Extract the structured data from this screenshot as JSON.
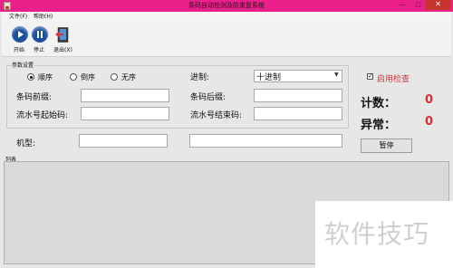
{
  "window": {
    "title": "条码自动检测及防重复系统",
    "controls": {
      "minimize": "—",
      "maximize": "□",
      "close": "✕"
    }
  },
  "menu": {
    "file": "文件(F)",
    "help": "帮助(H)"
  },
  "toolbar": {
    "start": "开始",
    "stop": "停止",
    "exit": "退出(X)"
  },
  "params": {
    "title": "参数设置",
    "order": {
      "asc": "顺序",
      "desc": "倒序",
      "none": "无序",
      "selected": "asc"
    },
    "base_label": "进制:",
    "base_value": "十进制",
    "prefix_label": "条码前缀:",
    "suffix_label": "条码后缀:",
    "serial_start_label": "流水号起始码:",
    "serial_end_label": "流水号结束码:",
    "prefix_value": "",
    "suffix_value": "",
    "serial_start_value": "",
    "serial_end_value": ""
  },
  "model": {
    "label": "机型:",
    "value": "",
    "value2": ""
  },
  "right_panel": {
    "enable_check_label": "启用检查",
    "enable_checked": true,
    "count_label": "计数：",
    "count_value": "0",
    "error_label": "异常：",
    "error_value": "0",
    "pause_label": "暂停"
  },
  "list": {
    "label": "列表"
  },
  "watermark": "软件技巧",
  "colors": {
    "titlebar": "#ea1f8a",
    "accent_red": "#d42e2e",
    "toolbar_icon": "#1a4f9e"
  }
}
